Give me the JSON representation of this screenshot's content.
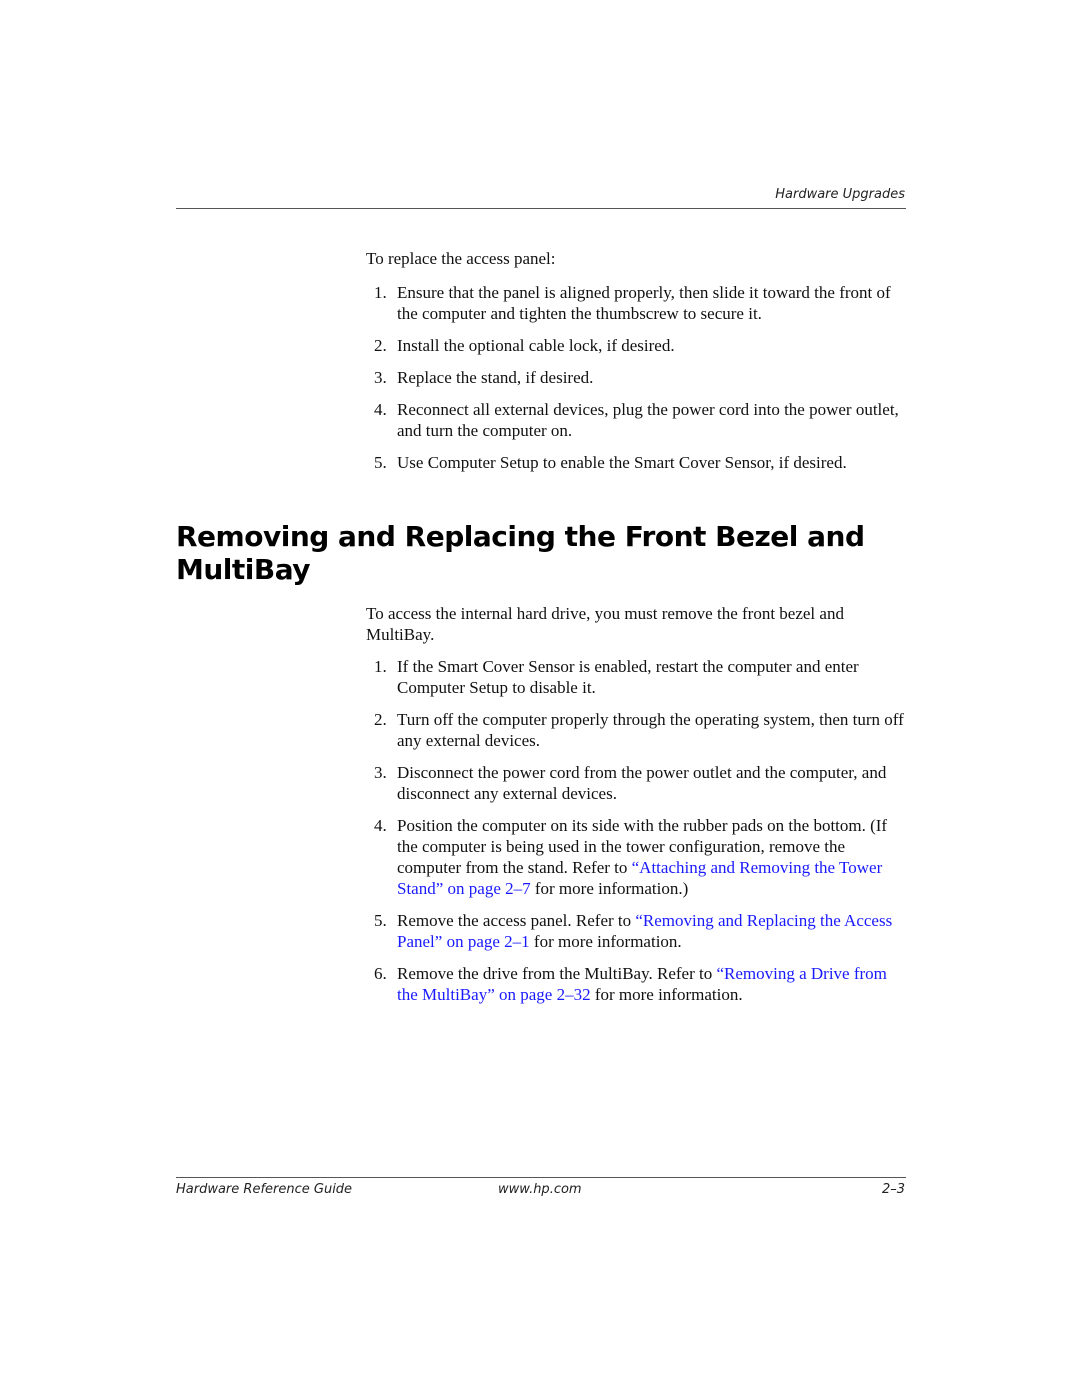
{
  "header": {
    "running_title": "Hardware Upgrades"
  },
  "replace_panel": {
    "intro": "To replace the access panel:",
    "steps": [
      {
        "num": "1.",
        "text": "Ensure that the panel is aligned properly, then slide it toward the front of the computer and tighten the thumbscrew to secure it."
      },
      {
        "num": "2.",
        "text": "Install the optional cable lock, if desired."
      },
      {
        "num": "3.",
        "text": "Replace the stand, if desired."
      },
      {
        "num": "4.",
        "text": "Reconnect all external devices, plug the power cord into the power outlet, and turn the computer on."
      },
      {
        "num": "5.",
        "text": "Use Computer Setup to enable the Smart Cover Sensor, if desired."
      }
    ]
  },
  "section": {
    "title": "Removing and Replacing the Front Bezel and MultiBay",
    "intro": "To access the internal hard drive, you must remove the front bezel and MultiBay.",
    "steps": [
      {
        "num": "1.",
        "text": "If the Smart Cover Sensor is enabled, restart the computer and enter Computer Setup to disable it."
      },
      {
        "num": "2.",
        "text": "Turn off the computer properly through the operating system, then turn off any external devices."
      },
      {
        "num": "3.",
        "text": "Disconnect the power cord from the power outlet and the computer, and disconnect any external devices."
      },
      {
        "num": "4.",
        "text_before": "Position the computer on its side with the rubber pads on the bottom. (If the computer is being used in the tower configuration, remove the computer from the stand. Refer to ",
        "link": "“Attaching and Removing the Tower Stand” on page 2–7",
        "text_after": " for more information.)"
      },
      {
        "num": "5.",
        "text_before": "Remove the access panel. Refer to ",
        "link": "“Removing and Replacing the Access Panel” on page 2–1",
        "text_after": " for more information."
      },
      {
        "num": "6.",
        "text_before": "Remove the drive from the MultiBay. Refer to ",
        "link": "“Removing a Drive from the MultiBay” on page 2–32",
        "text_after": " for more information."
      }
    ]
  },
  "footer": {
    "guide_title": "Hardware Reference Guide",
    "url": "www.hp.com",
    "page_number": "2–3"
  },
  "colors": {
    "link": "#1a1aff",
    "text": "#111111",
    "rule": "#555555"
  }
}
